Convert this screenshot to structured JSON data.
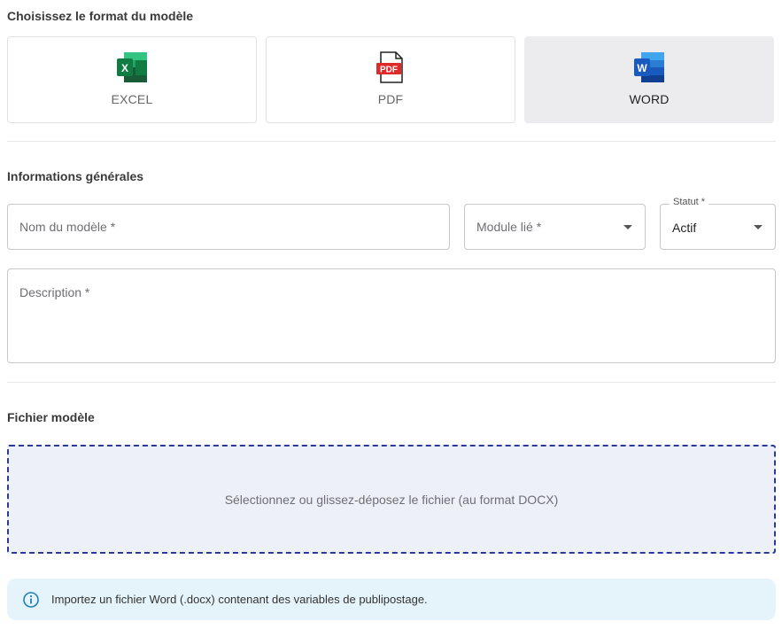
{
  "format_section": {
    "title": "Choisissez le format du modèle",
    "options": [
      {
        "label": "EXCEL",
        "icon": "excel-icon",
        "selected": false
      },
      {
        "label": "PDF",
        "icon": "pdf-icon",
        "selected": false
      },
      {
        "label": "WORD",
        "icon": "word-icon",
        "selected": true
      }
    ]
  },
  "general_section": {
    "title": "Informations générales",
    "name_field": {
      "placeholder": "Nom du modèle *"
    },
    "module_field": {
      "placeholder": "Module lié *"
    },
    "status_field": {
      "label": "Statut *",
      "value": "Actif"
    },
    "description_field": {
      "placeholder": "Description *"
    }
  },
  "file_section": {
    "title": "Fichier modèle",
    "dropzone_text": "Sélectionnez ou glissez-déposez le fichier (au format DOCX)"
  },
  "info": {
    "icon": "info-icon",
    "text": "Importez un fichier Word (.docx) contenant des variables de publipostage."
  },
  "colors": {
    "excel": "#1d6f42",
    "pdf": "#e02929",
    "word": "#185abd",
    "dropzone_border": "#2b3a9a",
    "info_bg": "#e5f4fb"
  }
}
